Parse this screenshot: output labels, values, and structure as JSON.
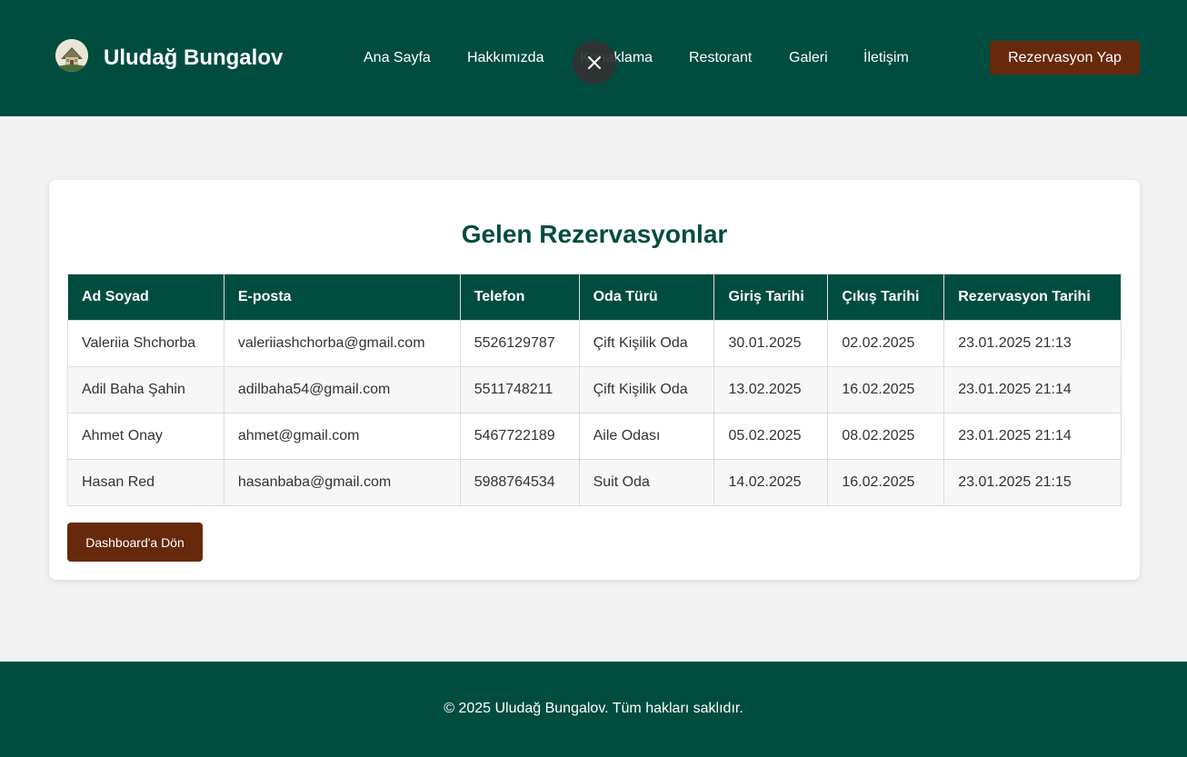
{
  "header": {
    "brand": "Uludağ Bungalov",
    "nav": [
      "Ana Sayfa",
      "Hakkımızda",
      "Konaklama",
      "Restorant",
      "Galeri",
      "İletişim"
    ],
    "cta_label": "Rezervasyon Yap",
    "close_icon": "close-icon"
  },
  "main": {
    "title": "Gelen Rezervasyonlar",
    "columns": [
      "Ad Soyad",
      "E-posta",
      "Telefon",
      "Oda Türü",
      "Giriş Tarihi",
      "Çıkış Tarihi",
      "Rezervasyon Tarihi"
    ],
    "rows": [
      [
        "Valeriia Shchorba",
        "valeriiashchorba@gmail.com",
        "5526129787",
        "Çift Kişilik Oda",
        "30.01.2025",
        "02.02.2025",
        "23.01.2025 21:13"
      ],
      [
        "Adil Baha Şahin",
        "adilbaha54@gmail.com",
        "5511748211",
        "Çift Kişilik Oda",
        "13.02.2025",
        "16.02.2025",
        "23.01.2025 21:14"
      ],
      [
        "Ahmet Onay",
        "ahmet@gmail.com",
        "5467722189",
        "Aile Odası",
        "05.02.2025",
        "08.02.2025",
        "23.01.2025 21:14"
      ],
      [
        "Hasan Red",
        "hasanbaba@gmail.com",
        "5988764534",
        "Suit Oda",
        "14.02.2025",
        "16.02.2025",
        "23.01.2025 21:15"
      ]
    ],
    "back_label": "Dashboard'a Dön"
  },
  "footer": {
    "text": "© 2025 Uludağ Bungalov. Tüm hakları saklıdır."
  },
  "colors": {
    "primary": "#004d40",
    "accent": "#66290c",
    "background": "#f2f2f2"
  }
}
